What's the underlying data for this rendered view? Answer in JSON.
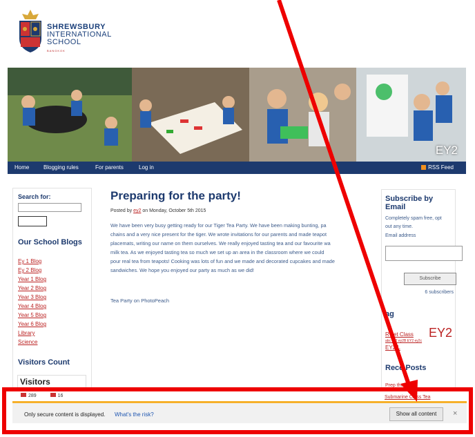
{
  "school": {
    "line1": "SHREWSBURY",
    "line2": "INTERNATIONAL",
    "line3": "SCHOOL",
    "line4": "BANGKOK"
  },
  "banner": {
    "label": "EY2"
  },
  "nav": {
    "items": [
      "Home",
      "Blogging rules",
      "For parents",
      "Log in"
    ],
    "rss": "RSS Feed"
  },
  "sidebar_left": {
    "search_title": "Search for:",
    "blogs_title": "Our School Blogs",
    "blogs": [
      "Ey 1 Blog",
      "Ey 2 Blog",
      "Year 1 Blog",
      "Year 2 Blog",
      "Year 3 Blog",
      "Year 4 Blog",
      "Year 5 Blog",
      "Year 6 Blog",
      "Library",
      "Science"
    ],
    "visitors_title": "Visitors Count",
    "visitors_box_title": "Visitors",
    "visitors_a": "289",
    "visitors_b": "16"
  },
  "post": {
    "title": "Preparing for the party!",
    "meta_prefix": "Posted by",
    "author": "ey2",
    "meta_suffix": "on Monday, October 5th 2015",
    "body": [
      "We have been very busy getting ready for our Tiger Tea Party. We have been making bunting, pa",
      "chains and a very nice present for the tiger. We wrote invitations for our parents and made teapot",
      "placemats, writing our name on them ourselves. We really enjoyed tasting tea and our favourite wa",
      "milk tea. As we enjoyed tasting tea so much we set up an area in the classroom where we could",
      "pour real tea from teapots! Cooking was lots of fun and we made and decorated cupcakes and made",
      "sandwiches. We hope you enjoyed our party as much as we did!"
    ],
    "photo_link": "Tea Party on PhotoPeach"
  },
  "sidebar_right": {
    "subscribe_title": "Subscribe by Email",
    "subscribe_text1": "Completely spam free, opt",
    "subscribe_text2": "out any time.",
    "email_label": "Email address",
    "subscribe_button": "Subscribe",
    "subscribers": "6 subscribers",
    "tags_title": "ag",
    "tag_large": "EY2",
    "tag_rocket": "R    ket Class",
    "tag_ey2l": "EY2 L",
    "tag_tiny": "abc ey2 ey2B EY2 ey2c",
    "recent_title": "Rece    Posts",
    "recent_1": "Prep            the party!",
    "recent_2": "Submarine Class Tea"
  },
  "security_bar": {
    "message": "Only secure content is displayed.",
    "risk_link": "What's the risk?",
    "show_button": "Show all content",
    "close": "×"
  },
  "colors": {
    "navy": "#1d3a6e",
    "link_red": "#bb2222",
    "annotation_red": "#ee0000",
    "warning_orange": "#f6b02a"
  }
}
